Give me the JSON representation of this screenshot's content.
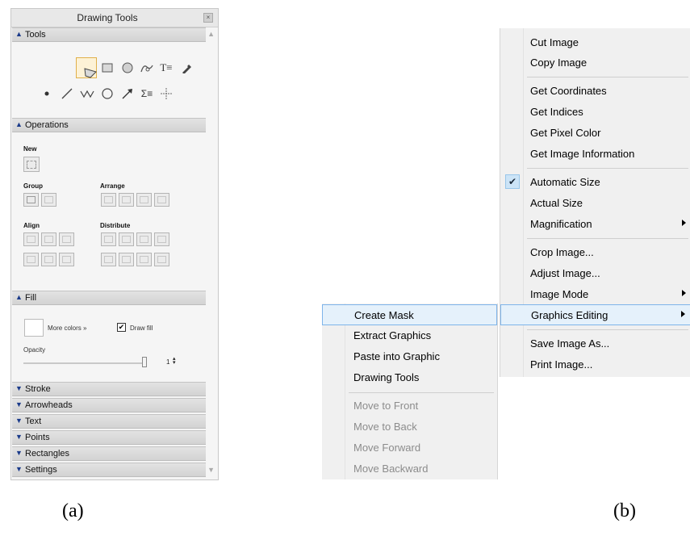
{
  "palette": {
    "title": "Drawing Tools",
    "close_glyph": "×",
    "sections": {
      "tools": {
        "label": "Tools",
        "expanded": true
      },
      "operations": {
        "label": "Operations",
        "expanded": true
      },
      "fill": {
        "label": "Fill",
        "expanded": true
      },
      "collapsed": [
        "Stroke",
        "Arrowheads",
        "Text",
        "Points",
        "Rectangles",
        "Settings"
      ]
    },
    "tools_row1": [
      "arrow-pointer-icon",
      "rectangle-icon",
      "polygon-icon",
      "disk-icon",
      "freehand-icon",
      "text-icon",
      "dropper-icon"
    ],
    "tools_row2": [
      "point-icon",
      "line-icon",
      "polyline-icon",
      "circle-icon",
      "arrow-icon",
      "math-text-icon",
      "crosshair-icon"
    ],
    "selected_tool": "polygon-icon",
    "operations": {
      "new_label": "New",
      "group_label": "Group",
      "arrange_label": "Arrange",
      "align_label": "Align",
      "distribute_label": "Distribute"
    },
    "fill": {
      "more_colors": "More colors »",
      "draw_fill_label": "Draw fill",
      "draw_fill_checked": true,
      "opacity_label": "Opacity",
      "opacity_value": "1"
    }
  },
  "menu": {
    "items": [
      "Cut Image",
      "Copy Image",
      "Get Coordinates",
      "Get Indices",
      "Get Pixel Color",
      "Get Image Information",
      "Automatic Size",
      "Actual Size",
      "Magnification",
      "Crop Image...",
      "Adjust Image...",
      "Image Mode",
      "Graphics Editing",
      "Save Image As...",
      "Print Image..."
    ],
    "checked_item": "Automatic Size",
    "highlighted_item": "Graphics Editing",
    "check_glyph": "✔"
  },
  "submenu": {
    "items": [
      "Create Mask",
      "Extract Graphics",
      "Paste into Graphic",
      "Drawing Tools"
    ],
    "disabled_items": [
      "Move to Front",
      "Move to Back",
      "Move Forward",
      "Move Backward"
    ],
    "highlighted_item": "Create Mask"
  },
  "captions": {
    "a": "(a)",
    "b": "(b)"
  },
  "colors": {
    "highlight_bg": "#e5f1fb",
    "highlight_border": "#7eb4ea",
    "section_chevron": "#1a3a8a",
    "selected_tool_border": "#e0b04a"
  }
}
